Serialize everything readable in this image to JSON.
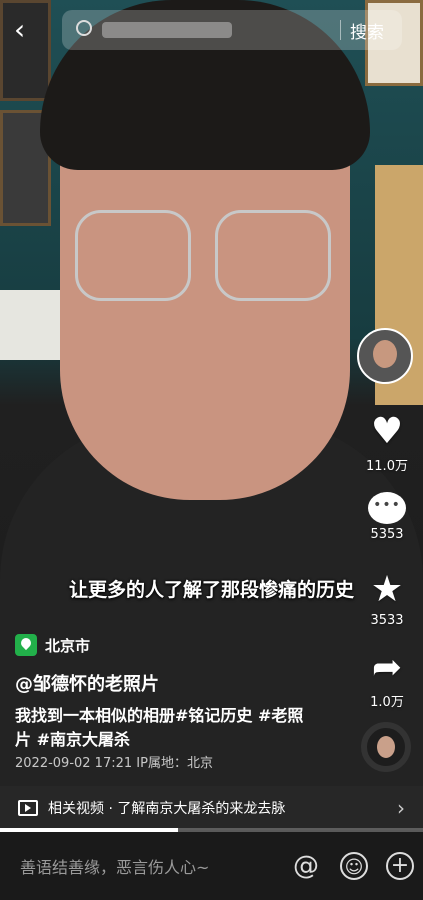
{
  "search": {
    "button_label": "搜索"
  },
  "rail": {
    "likes": "11.0万",
    "comments": "5353",
    "favorites": "3533",
    "shares": "1.0万"
  },
  "video": {
    "subtitle": "让更多的人了解了那段惨痛的历史",
    "location": "北京市",
    "author": "@邹德怀的老照片",
    "description": "我找到一本相似的相册#铭记历史 #老照片 #南京大屠杀",
    "meta": "2022-09-02 17:21  IP属地：北京",
    "progress": 0.42
  },
  "related": {
    "text": "相关视频 · 了解南京大屠杀的来龙去脉"
  },
  "bottom": {
    "comment_placeholder": "善语结善缘，恶言伤人心~"
  }
}
